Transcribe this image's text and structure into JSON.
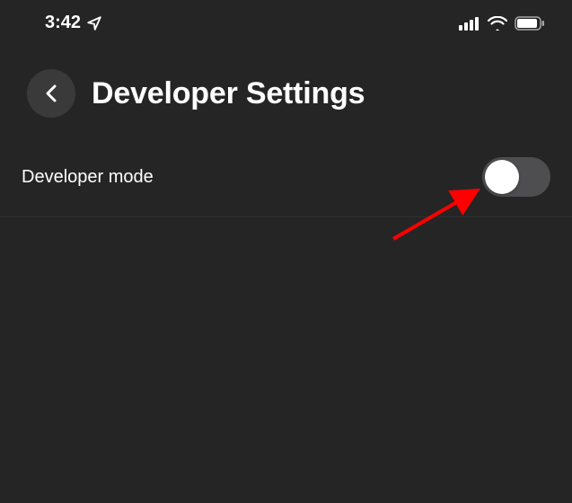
{
  "status_bar": {
    "time": "3:42",
    "location_icon": "location-arrow-icon",
    "signal_icon": "cellular-signal-icon",
    "wifi_icon": "wifi-icon",
    "battery_icon": "battery-icon"
  },
  "header": {
    "back_icon": "chevron-left-icon",
    "title": "Developer Settings"
  },
  "settings": {
    "developer_mode": {
      "label": "Developer mode",
      "enabled": false
    }
  },
  "annotation": {
    "type": "arrow",
    "color": "#ff0000",
    "points_to": "developer-mode-toggle"
  }
}
